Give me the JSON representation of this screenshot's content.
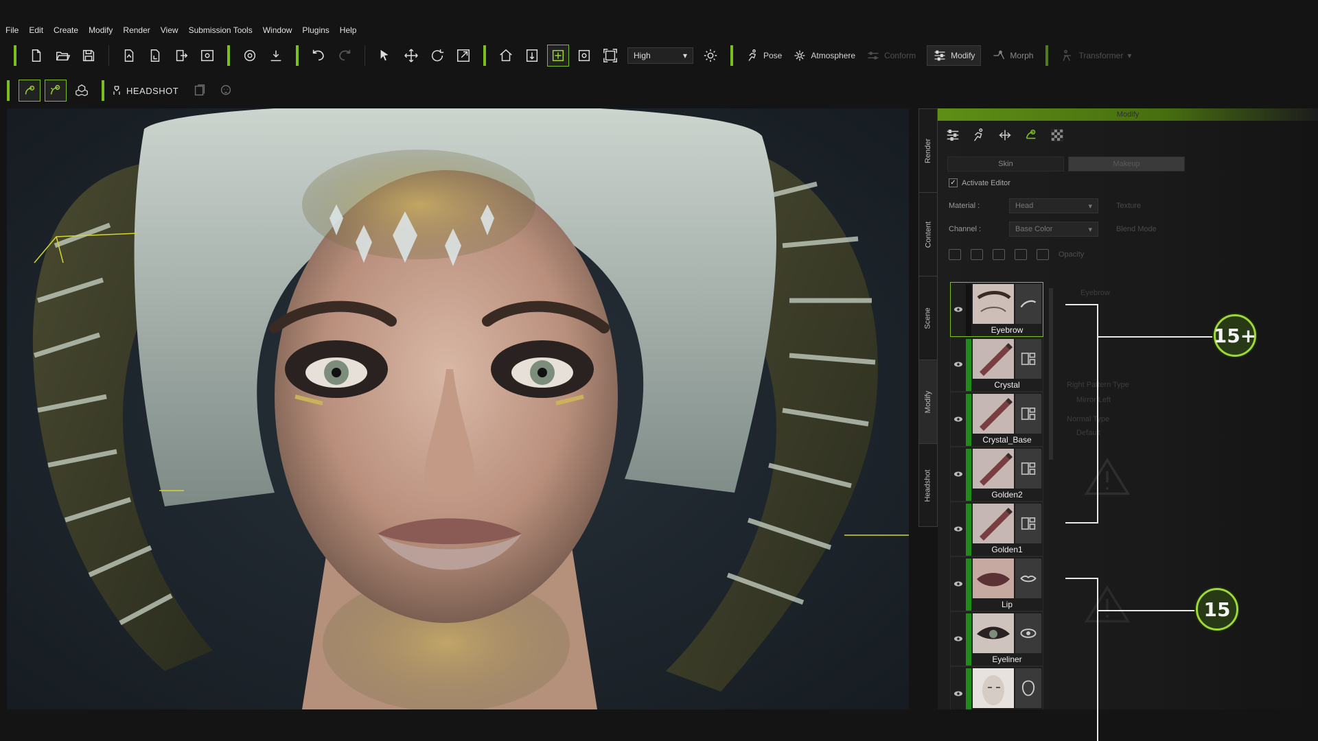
{
  "menu": [
    "File",
    "Edit",
    "Create",
    "Modify",
    "Render",
    "View",
    "Submission Tools",
    "Window",
    "Plugins",
    "Help"
  ],
  "toolbar": {
    "quality_select": "High",
    "pose_label": "Pose",
    "atmosphere_label": "Atmosphere",
    "conform_label": "Conform",
    "modify_label": "Modify",
    "morph_label": "Morph",
    "transformer_label": "Transformer"
  },
  "toolbar2": {
    "headshot_label": "HEADSHOT"
  },
  "side_tabs": [
    "Render",
    "Content",
    "Scene",
    "Modify",
    "Headshot"
  ],
  "panel": {
    "title": "Modify",
    "tabs": [
      "Skin",
      "Makeup"
    ],
    "activate_label": "Activate Editor",
    "material_label": "Material :",
    "material_value": "Head",
    "texture_label": "Texture",
    "channel_label": "Channel :",
    "channel_value": "Base Color",
    "blend_label": "Blend Mode",
    "opacity_label": "Opacity",
    "ghost": {
      "layer_title": "Eyebrow",
      "right_pattern": "Right Pattern Type",
      "mirror": "Mirror Left",
      "normal_type": "Normal Type",
      "default": "Default"
    }
  },
  "layers": [
    {
      "name": "Eyebrow",
      "selected": true,
      "thumb": "eyebrow",
      "sub_icon": "eyebrow-icon"
    },
    {
      "name": "Crystal",
      "selected": false,
      "thumb": "brush",
      "sub_icon": "layers-icon"
    },
    {
      "name": "Crystal_Base",
      "selected": false,
      "thumb": "brush",
      "sub_icon": "layers-icon"
    },
    {
      "name": "Golden2",
      "selected": false,
      "thumb": "brush",
      "sub_icon": "layers-icon"
    },
    {
      "name": "Golden1",
      "selected": false,
      "thumb": "brush",
      "sub_icon": "layers-icon"
    },
    {
      "name": "Lip",
      "selected": false,
      "thumb": "lip",
      "sub_icon": "lip-icon"
    },
    {
      "name": "Eyeliner",
      "selected": false,
      "thumb": "eye",
      "sub_icon": "eye-icon"
    },
    {
      "name": "",
      "selected": false,
      "thumb": "face",
      "sub_icon": "head-icon"
    }
  ],
  "annotations": {
    "badge_top": "15+",
    "badge_bottom": "15"
  },
  "colors": {
    "accent": "#7cbf1e",
    "layer_bar": "#1f8c1a",
    "badge_ring": "#9fd63a"
  }
}
